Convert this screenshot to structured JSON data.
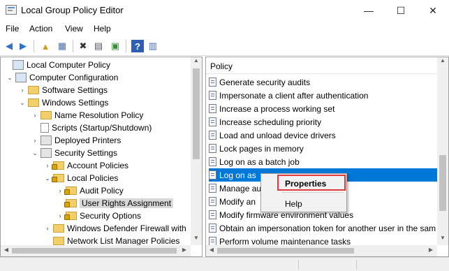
{
  "window": {
    "title": "Local Group Policy Editor",
    "minimize": "—",
    "maximize": "☐",
    "close": "✕"
  },
  "menu": [
    "File",
    "Action",
    "View",
    "Help"
  ],
  "toolbar": {
    "back": "◀",
    "forward": "▶",
    "up": "▲",
    "show_hide": "▦",
    "delete": "✖",
    "properties": "▤",
    "export": "▣",
    "help": "?",
    "extended": "▥"
  },
  "tree": [
    {
      "label": "Local Computer Policy",
      "icon": "computer-policy-icon"
    },
    {
      "label": "Computer Configuration",
      "icon": "computer-icon",
      "twisty": "⌄"
    },
    {
      "label": "Software Settings",
      "icon": "folder-icon",
      "twisty": "›"
    },
    {
      "label": "Windows Settings",
      "icon": "folder-icon",
      "twisty": "⌄"
    },
    {
      "label": "Name Resolution Policy",
      "icon": "folder-icon",
      "twisty": "›"
    },
    {
      "label": "Scripts (Startup/Shutdown)",
      "icon": "script-icon"
    },
    {
      "label": "Deployed Printers",
      "icon": "printer-icon",
      "twisty": "›"
    },
    {
      "label": "Security Settings",
      "icon": "security-settings-icon",
      "twisty": "⌄"
    },
    {
      "label": "Account Policies",
      "icon": "folder-lock-icon",
      "twisty": "›"
    },
    {
      "label": "Local Policies",
      "icon": "folder-lock-icon",
      "twisty": "⌄"
    },
    {
      "label": "Audit Policy",
      "icon": "folder-lock-icon",
      "twisty": "›"
    },
    {
      "label": "User Rights Assignment",
      "icon": "folder-lock-icon",
      "selected": true
    },
    {
      "label": "Security Options",
      "icon": "folder-lock-icon",
      "twisty": "›"
    },
    {
      "label": "Windows Defender Firewall with",
      "icon": "folder-icon",
      "twisty": "›"
    },
    {
      "label": "Network List Manager Policies",
      "icon": "folder-icon"
    }
  ],
  "policy_header": "Policy",
  "policies": [
    "Generate security audits",
    "Impersonate a client after authentication",
    "Increase a process working set",
    "Increase scheduling priority",
    "Load and unload device drivers",
    "Lock pages in memory",
    "Log on as a batch job",
    "Log on as",
    "Manage au",
    "Modify an",
    "Modify firmware environment values",
    "Obtain an impersonation token for another user in the sam",
    "Perform volume maintenance tasks"
  ],
  "highlighted_index": 7,
  "context_menu": {
    "properties": "Properties",
    "help": "Help"
  },
  "accent": "#0078d7",
  "highlight_box": "#e0393e"
}
